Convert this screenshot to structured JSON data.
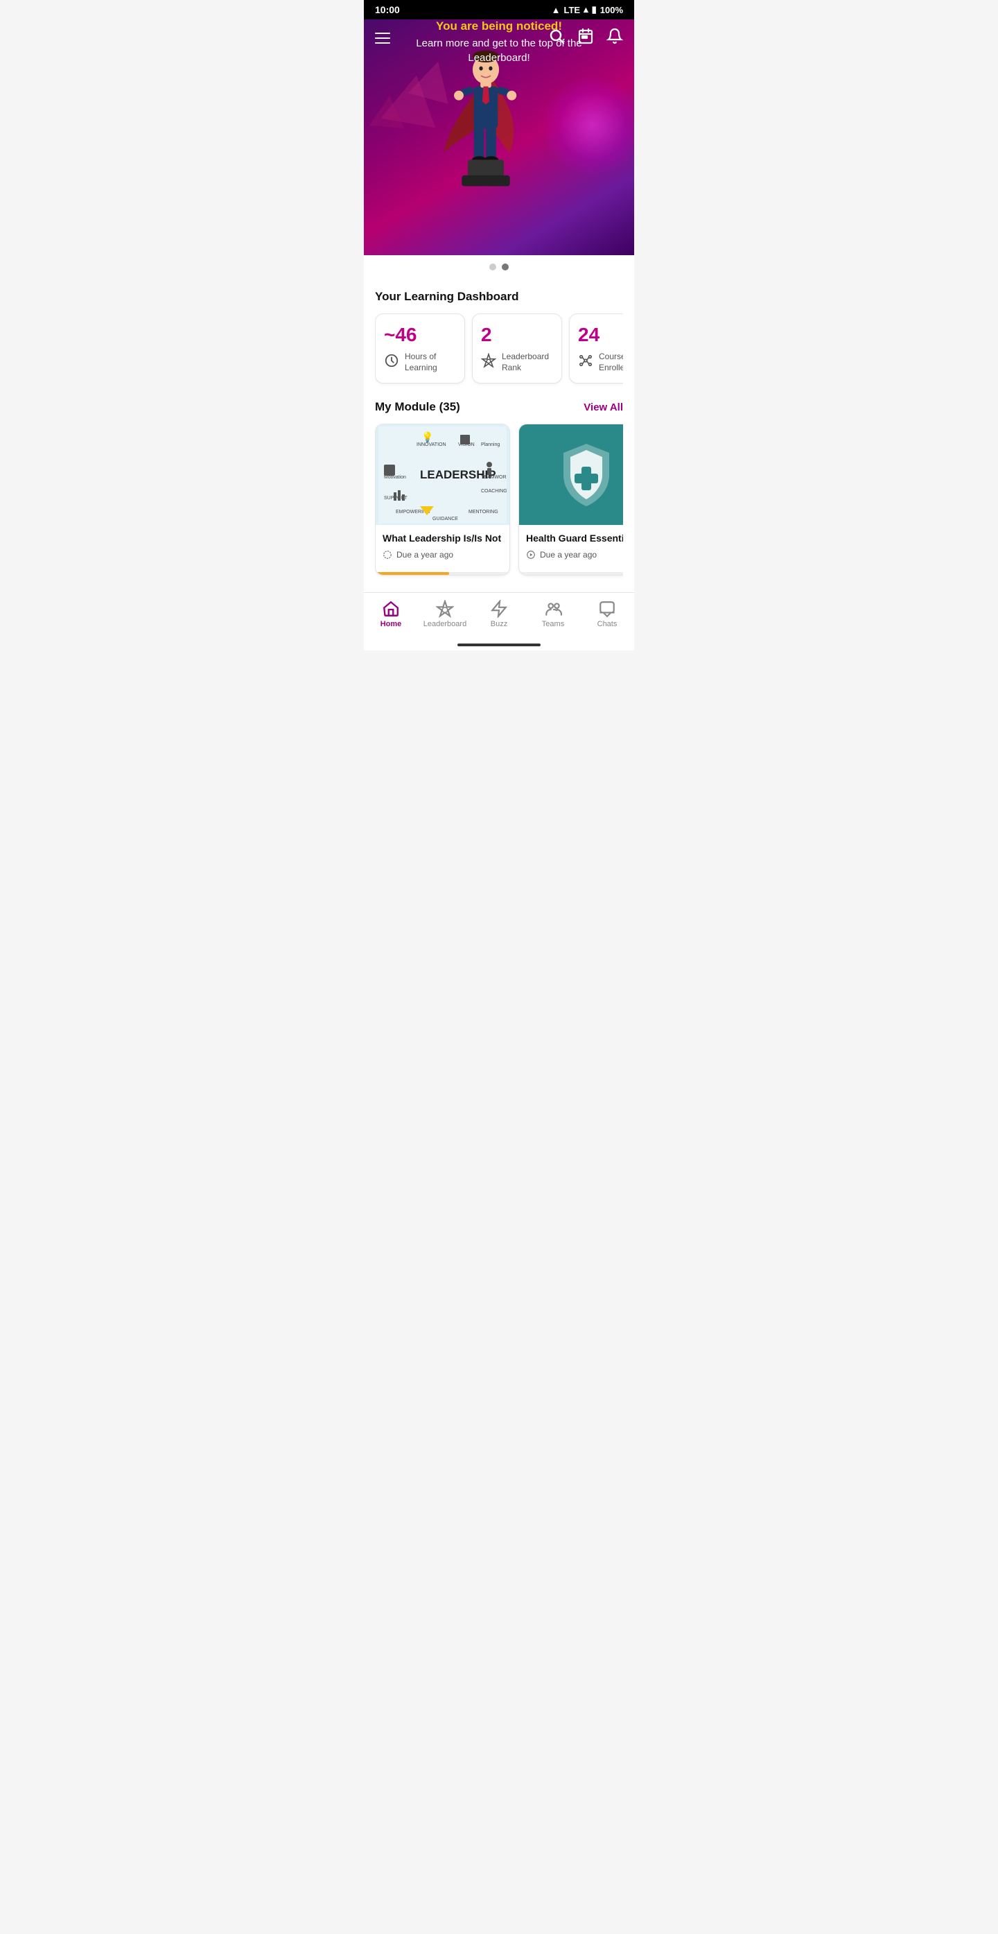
{
  "statusBar": {
    "time": "10:00",
    "signal": "LTE",
    "battery": "100%"
  },
  "hero": {
    "highlight": "You are being noticed!",
    "subtitle": "Learn more and get to the top of the Leaderboard!",
    "dots": [
      {
        "active": false
      },
      {
        "active": true
      }
    ]
  },
  "dashboard": {
    "title": "Your Learning Dashboard",
    "cards": [
      {
        "value": "~46",
        "label": "Hours of Learning",
        "icon": "clock"
      },
      {
        "value": "2",
        "label": "Leaderboard Rank",
        "icon": "trophy"
      },
      {
        "value": "24",
        "label": "Courses Enrolled",
        "icon": "network"
      }
    ]
  },
  "modules": {
    "title": "My Module",
    "count": 35,
    "viewAllLabel": "View All",
    "items": [
      {
        "title": "What Leadership Is/Is Not",
        "due": "Due a year ago",
        "progress": 55,
        "type": "leadership"
      },
      {
        "title": "Health Guard Essentials",
        "due": "Due a year ago",
        "progress": 0,
        "type": "health"
      }
    ]
  },
  "bottomNav": {
    "items": [
      {
        "id": "home",
        "label": "Home",
        "icon": "home",
        "active": true
      },
      {
        "id": "leaderboard",
        "label": "Leaderboard",
        "icon": "trophy",
        "active": false
      },
      {
        "id": "buzz",
        "label": "Buzz",
        "icon": "bolt",
        "active": false
      },
      {
        "id": "teams",
        "label": "Teams",
        "icon": "team",
        "active": false
      },
      {
        "id": "chats",
        "label": "Chats",
        "icon": "chat",
        "active": false
      }
    ]
  }
}
